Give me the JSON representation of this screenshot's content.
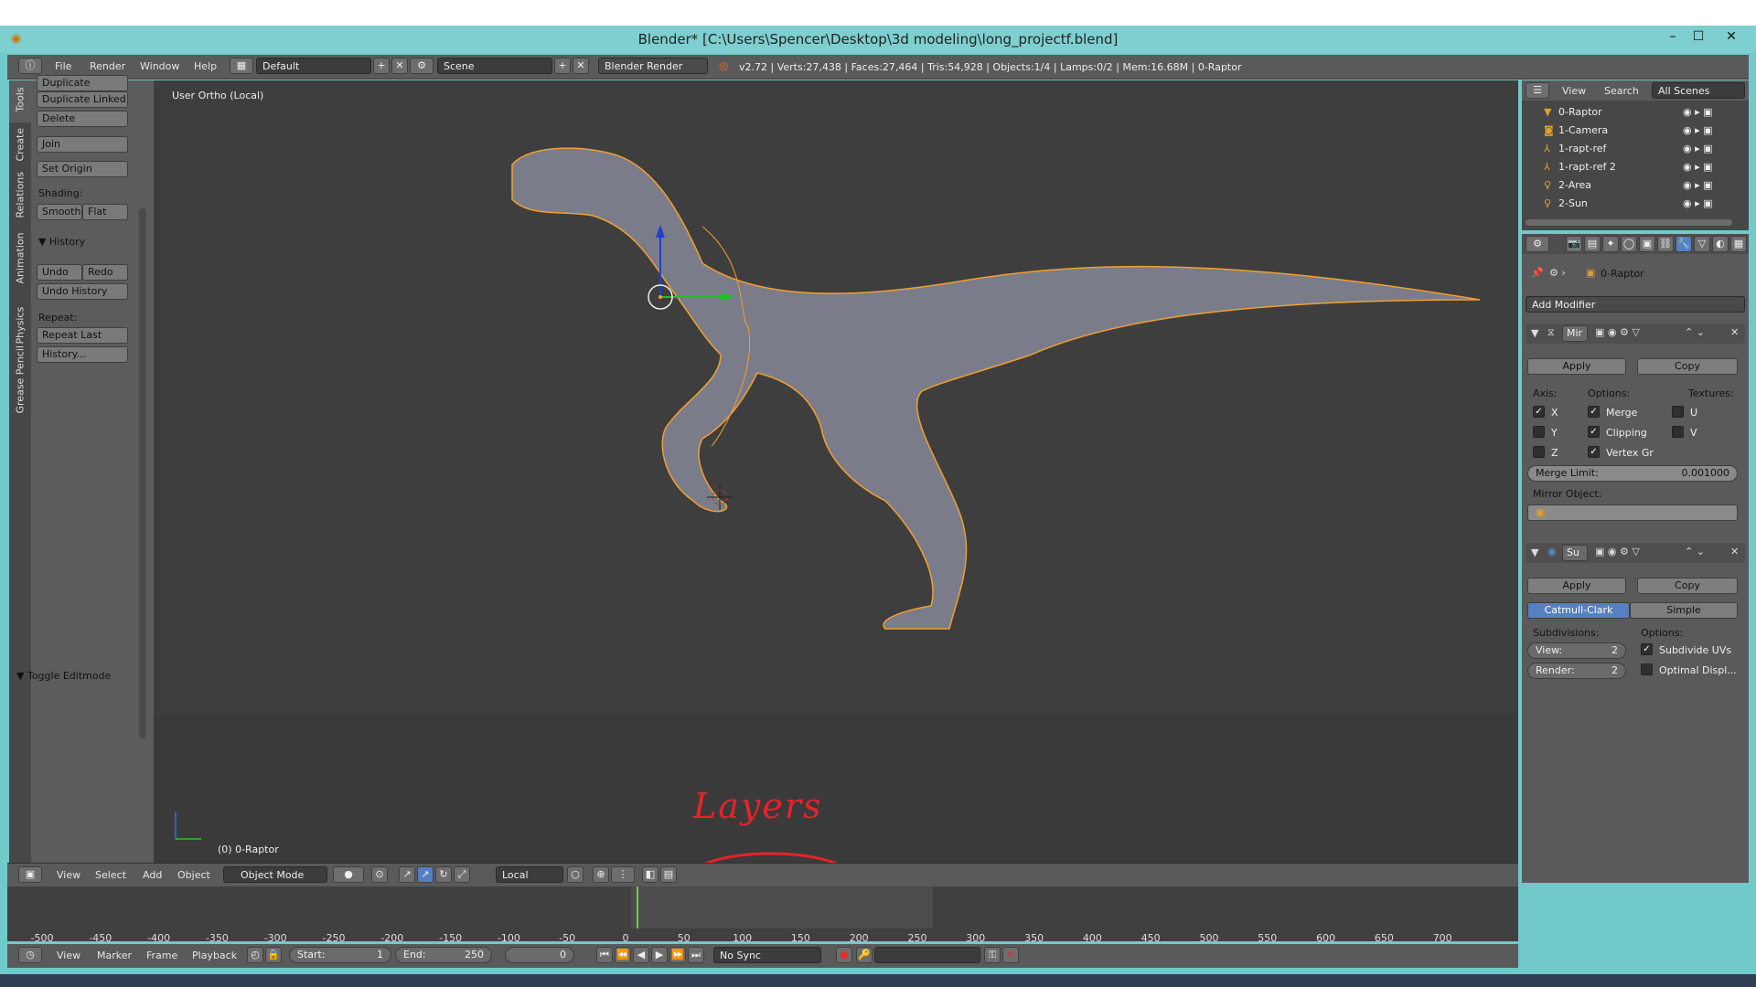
{
  "window": {
    "title": "Blender* [C:\\Users\\Spencer\\Desktop\\3d modeling\\long_projectf.blend]",
    "controls": [
      "–",
      "☐",
      "✕"
    ]
  },
  "menubar": {
    "items": [
      "File",
      "Render",
      "Window",
      "Help"
    ],
    "layout": "Default",
    "scene": "Scene",
    "engine": "Blender Render",
    "stats": "v2.72 | Verts:27,438 | Faces:27,464 | Tris:54,928 | Objects:1/4 | Lamps:0/2 | Mem:16.68M | 0-Raptor"
  },
  "tool_tabs": [
    "Tools",
    "Create",
    "Relations",
    "Animation",
    "Physics",
    "Grease Pencil"
  ],
  "toolshelf": {
    "duplicate": "Duplicate",
    "duplicate_linked": "Duplicate Linked",
    "delete": "Delete",
    "join": "Join",
    "set_origin": "Set Origin",
    "shading_label": "Shading:",
    "smooth": "Smooth",
    "flat": "Flat",
    "history_panel": "History",
    "undo": "Undo",
    "redo": "Redo",
    "undo_history": "Undo History",
    "repeat_label": "Repeat:",
    "repeat_last": "Repeat Last",
    "history_btn": "History...",
    "toggle_editmode": "Toggle Editmode"
  },
  "viewport": {
    "view_label": "User Ortho (Local)",
    "object_label": "(0) 0-Raptor",
    "annotation": "Layers"
  },
  "header3d": {
    "items": [
      "View",
      "Select",
      "Add",
      "Object"
    ],
    "mode": "Object Mode",
    "pivot": "Local"
  },
  "timeline": {
    "ticks": [
      "-500",
      "-450",
      "-400",
      "-350",
      "-300",
      "-250",
      "-200",
      "-150",
      "-100",
      "-50",
      "0",
      "50",
      "100",
      "150",
      "200",
      "250",
      "300",
      "350",
      "400",
      "450",
      "500",
      "550",
      "600",
      "650",
      "700"
    ],
    "menu": [
      "View",
      "Marker",
      "Frame",
      "Playback"
    ],
    "start_label": "Start:",
    "start_value": "1",
    "end_label": "End:",
    "end_value": "250",
    "current": "0",
    "sync": "No Sync"
  },
  "outliner": {
    "view": "View",
    "search": "Search",
    "scenes": "All Scenes",
    "items": [
      "0-Raptor",
      "1-Camera",
      "1-rapt-ref",
      "1-rapt-ref 2",
      "2-Area",
      "2-Sun"
    ]
  },
  "properties": {
    "object": "0-Raptor",
    "add_modifier": "Add Modifier",
    "mirror": {
      "name": "Mir",
      "apply": "Apply",
      "copy": "Copy",
      "axis_label": "Axis:",
      "options_label": "Options:",
      "textures_label": "Textures:",
      "x": "X",
      "y": "Y",
      "z": "Z",
      "merge": "Merge",
      "clipping": "Clipping",
      "vertex_gr": "Vertex Gr",
      "u": "U",
      "v": "V",
      "merge_limit_label": "Merge Limit:",
      "merge_limit_value": "0.001000",
      "mirror_object_label": "Mirror Object:"
    },
    "subsurf": {
      "name": "Su",
      "apply": "Apply",
      "copy": "Copy",
      "catmull": "Catmull-Clark",
      "simple": "Simple",
      "subdivisions_label": "Subdivisions:",
      "options_label": "Options:",
      "view_label": "View:",
      "view_value": "2",
      "render_label": "Render:",
      "render_value": "2",
      "subdivide_uvs": "Subdivide UVs",
      "optimal": "Optimal Displ..."
    }
  },
  "colors": {
    "accent_blue": "#5680c2",
    "selection_orange": "#f0a030",
    "annotation_red": "#e8222a"
  }
}
